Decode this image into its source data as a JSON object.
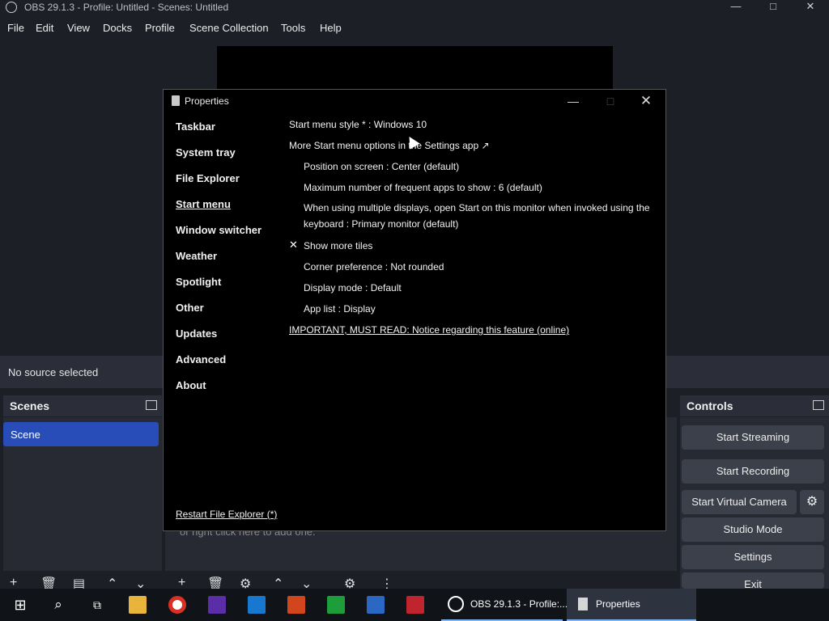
{
  "window": {
    "title": "OBS 29.1.3 - Profile: Untitled - Scenes: Untitled",
    "minimize": "—",
    "maximize": "□",
    "close": "✕"
  },
  "menubar": [
    "File",
    "Edit",
    "View",
    "Docks",
    "Profile",
    "Scene Collection",
    "Tools",
    "Help"
  ],
  "source_bar": {
    "text": "No source selected"
  },
  "scenes": {
    "header": "Scenes",
    "items": [
      "Scene"
    ]
  },
  "sources": {
    "hint": "or right click here to add one."
  },
  "controls": {
    "header": "Controls",
    "buttons": [
      "Start Streaming",
      "Start Recording",
      "Start Virtual Camera",
      "Studio Mode",
      "Settings",
      "Exit"
    ]
  },
  "dialog": {
    "title": "Properties",
    "nav": [
      "Taskbar",
      "System tray",
      "File Explorer",
      "Start menu",
      "Window switcher",
      "Weather",
      "Spotlight",
      "Other",
      "Updates",
      "Advanced",
      "About"
    ],
    "selected_nav": "Start menu",
    "options": [
      "Start menu style * : Windows 10",
      "More Start menu options in the Settings app ↗",
      "Position on screen : Center (default)",
      "Maximum number of frequent apps to show : 6 (default)",
      "When using multiple displays, open Start on this monitor when invoked using the keyboard : Primary monitor (default)",
      "Show more tiles",
      "Corner preference : Not rounded",
      "Display mode : Default",
      "App list : Display",
      "IMPORTANT, MUST READ: Notice regarding this feature (online)"
    ],
    "show_more_tiles_checked": true,
    "check_glyph": "✕",
    "restart_link": "Restart File Explorer (*)"
  },
  "taskbar": {
    "tasks": [
      {
        "label": "OBS 29.1.3 - Profile:...",
        "active": false
      },
      {
        "label": "Properties",
        "active": true
      }
    ]
  },
  "colors": {
    "accent": "#284cb8",
    "dialog_bg": "#000000",
    "obs_bg": "#1d1f26"
  }
}
